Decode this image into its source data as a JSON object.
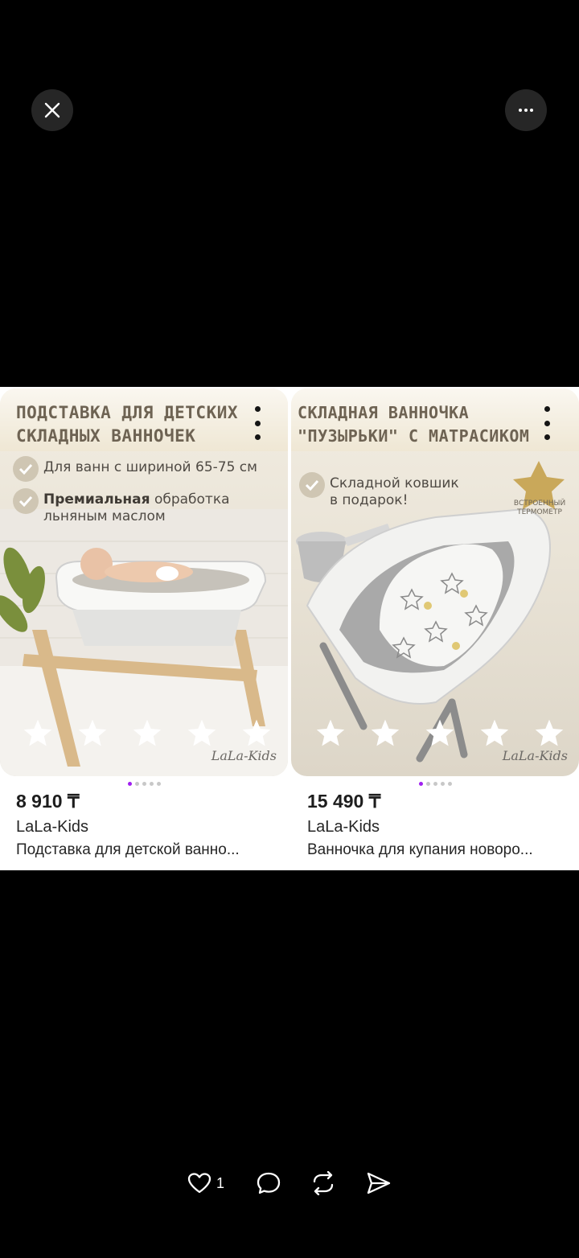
{
  "overlay": {
    "close_icon": "close-icon",
    "more_icon": "more-horizontal-icon"
  },
  "products": [
    {
      "image": {
        "headline_line1": "ПОДСТАВКА ДЛЯ ДЕТСКИХ",
        "headline_line2": "СКЛАДНЫХ ВАННОЧЕК",
        "bullet1": "Для ванн с шириной 65-75 см",
        "bullet2_bold": "Премиальная",
        "bullet2_rest": " обработка",
        "bullet2_line2": "льняным маслом",
        "logo": "LaLa-Kids",
        "rating_stars": 5
      },
      "carousel": {
        "count": 5,
        "active": 0
      },
      "price": "8 910 ₸",
      "brand": "LaLa-Kids",
      "title": "Подставка для детской ванно..."
    },
    {
      "image": {
        "headline_line1": "СКЛАДНАЯ ВАННОЧКА",
        "headline_line2": "\"ПУЗЫРЬКИ\" С МАТРАСИКОМ",
        "bullet1": "Складной ковшик",
        "bullet1_line2": "в подарок!",
        "thermo_label": "ВСТРОЕННЫЙ ТЕРМОМЕТР",
        "logo": "LaLa-Kids",
        "rating_stars": 5
      },
      "carousel": {
        "count": 5,
        "active": 0
      },
      "price": "15 490 ₸",
      "brand": "LaLa-Kids",
      "title": "Ванночка для купания новоро..."
    }
  ],
  "actions": {
    "like_count": "1",
    "like_icon": "heart-icon",
    "comment_icon": "comment-icon",
    "repost_icon": "repost-icon",
    "share_icon": "send-icon"
  },
  "colors": {
    "background": "#000000",
    "carousel_active": "#a020f0"
  }
}
